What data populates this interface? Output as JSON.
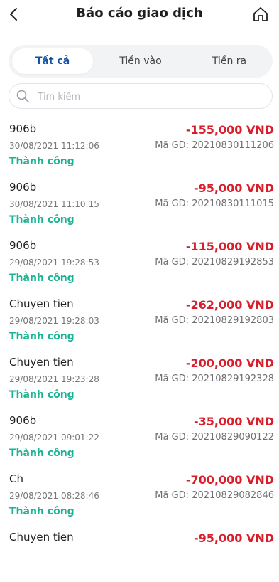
{
  "header": {
    "title": "Báo cáo giao dịch",
    "back_icon": "chevron-left-icon",
    "home_icon": "home-icon"
  },
  "tabs": [
    {
      "label": "Tất cả",
      "selected": true
    },
    {
      "label": "Tiền vào",
      "selected": false
    },
    {
      "label": "Tiền ra",
      "selected": false
    }
  ],
  "search": {
    "placeholder": "Tìm kiếm",
    "value": ""
  },
  "colors": {
    "accent": "#0f52a6",
    "negative_amount": "#d81e2a",
    "success": "#1ab394"
  },
  "transactions": [
    {
      "name": "906b",
      "amount": "-155,000 VND",
      "time": "30/08/2021 11:12:06",
      "ref_label": "Mã GD:",
      "ref": "20210830111206",
      "status": "Thành công"
    },
    {
      "name": "906b",
      "amount": "-95,000 VND",
      "time": "30/08/2021 11:10:15",
      "ref_label": "Mã GD:",
      "ref": "20210830111015",
      "status": "Thành công"
    },
    {
      "name": "906b",
      "amount": "-115,000 VND",
      "time": "29/08/2021 19:28:53",
      "ref_label": "Mã GD:",
      "ref": "20210829192853",
      "status": "Thành công"
    },
    {
      "name": "Chuyen tien",
      "amount": "-262,000 VND",
      "time": "29/08/2021 19:28:03",
      "ref_label": "Mã GD:",
      "ref": "20210829192803",
      "status": "Thành công"
    },
    {
      "name": "Chuyen tien",
      "amount": "-200,000 VND",
      "time": "29/08/2021 19:23:28",
      "ref_label": "Mã GD:",
      "ref": "20210829192328",
      "status": "Thành công"
    },
    {
      "name": "906b",
      "amount": "-35,000 VND",
      "time": "29/08/2021 09:01:22",
      "ref_label": "Mã GD:",
      "ref": "20210829090122",
      "status": "Thành công"
    },
    {
      "name": "Ch",
      "amount": "-700,000 VND",
      "time": "29/08/2021 08:28:46",
      "ref_label": "Mã GD:",
      "ref": "20210829082846",
      "status": "Thành công"
    },
    {
      "name": "Chuyen tien",
      "amount": "-95,000 VND",
      "time": "",
      "ref_label": "",
      "ref": "",
      "status": ""
    }
  ]
}
